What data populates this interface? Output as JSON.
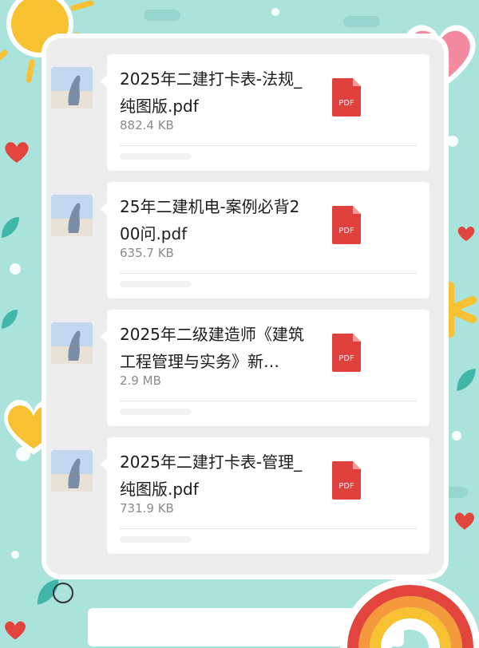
{
  "chat": {
    "messages": [
      {
        "name": "2025年二建打卡表-法规_纯图版.pdf",
        "size": "882.4 KB",
        "icon": "pdf-file-icon",
        "icon_label": "PDF"
      },
      {
        "name": "25年二建机电-案例必背200问.pdf",
        "size": "635.7 KB",
        "icon": "pdf-file-icon",
        "icon_label": "PDF"
      },
      {
        "name": "2025年二级建造师《建筑工程管理与实务》新…",
        "size": "2.9 MB",
        "icon": "pdf-file-icon",
        "icon_label": "PDF"
      },
      {
        "name": "2025年二建打卡表-管理_纯图版.pdf",
        "size": "731.9 KB",
        "icon": "pdf-file-icon",
        "icon_label": "PDF"
      }
    ]
  },
  "colors": {
    "background": "#a9e3dc",
    "pdf_red": "#e0413c",
    "bubble": "#ffffff",
    "panel": "#ededed"
  },
  "icons": {
    "voice": "voice-input-icon",
    "sun": "sun-sticker-icon",
    "heart": "heart-sticker-icon",
    "rainbow": "rainbow-sticker-icon",
    "star": "star-sticker-icon"
  }
}
